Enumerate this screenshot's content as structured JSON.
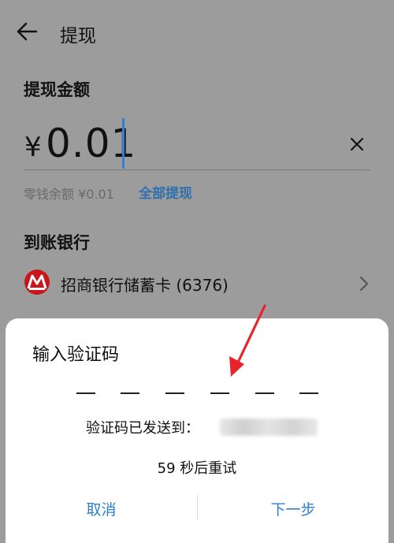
{
  "header": {
    "title": "提现",
    "back_icon": "arrow-left-icon"
  },
  "amount": {
    "section_title": "提现金额",
    "currency_symbol": "¥",
    "value": "0.01",
    "clear_icon": "close-icon",
    "balance_text": "零钱余额 ¥0.01",
    "withdraw_all_label": "全部提现"
  },
  "bank": {
    "section_title": "到账银行",
    "logo_icon": "cmb-bank-logo-icon",
    "name": "招商银行储蓄卡 (6376)",
    "chevron_icon": "chevron-right-icon"
  },
  "dialog": {
    "title": "输入验证码",
    "code_slots": 6,
    "sent_label": "验证码已发送到：",
    "resend_text": "59 秒后重试",
    "cancel_label": "取消",
    "next_label": "下一步"
  },
  "colors": {
    "accent_blue": "#2f7fc8",
    "cursor_blue": "#2f7fd6",
    "bank_red": "#c8161d",
    "arrow_red": "#e8232b",
    "dim_background": "#9c9c9c"
  }
}
